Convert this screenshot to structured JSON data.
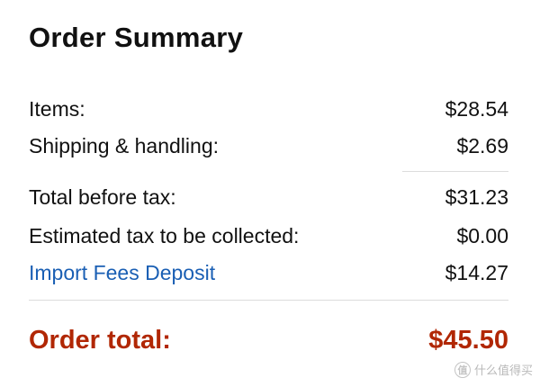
{
  "summary": {
    "title": "Order Summary",
    "rows": [
      {
        "label": "Items:",
        "value": "$28.54"
      },
      {
        "label": "Shipping & handling:",
        "value": "$2.69"
      },
      {
        "label": "Total before tax:",
        "value": "$31.23"
      },
      {
        "label": "Estimated tax to be collected:",
        "value": "$0.00"
      },
      {
        "label": "Import Fees Deposit",
        "value": "$14.27"
      }
    ],
    "total": {
      "label": "Order total:",
      "value": "$45.50"
    },
    "colors": {
      "total": "#b12704",
      "link": "#1a5fb4",
      "divider": "#dcdcdc"
    }
  },
  "watermark": {
    "logo_glyph": "值",
    "text": "什么值得买",
    "icon": "smzdm-logo-icon"
  }
}
